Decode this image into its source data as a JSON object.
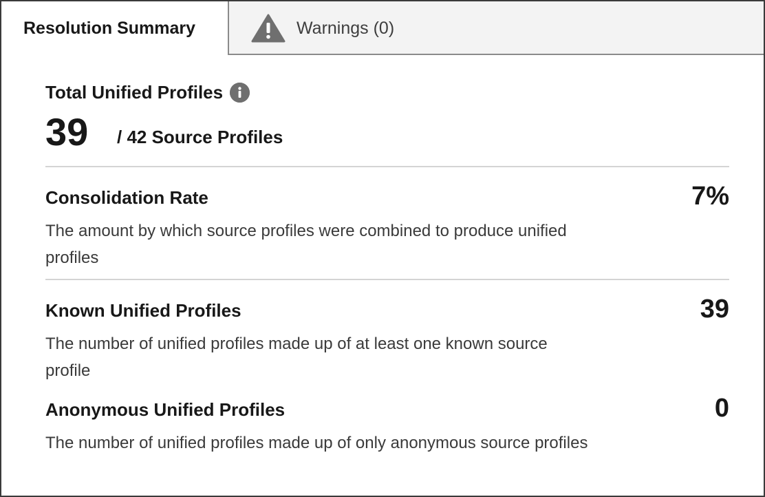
{
  "tabs": {
    "resolution_summary": "Resolution Summary",
    "warnings": "Warnings (0)"
  },
  "summary": {
    "total_title": "Total Unified Profiles",
    "total_value": "39",
    "total_of": "/ 42 Source Profiles"
  },
  "metrics": [
    {
      "title": "Consolidation Rate",
      "value": "7%",
      "description": "The amount by which source profiles were combined to produce unified profiles"
    },
    {
      "title": "Known Unified Profiles",
      "value": "39",
      "description": "The number of unified profiles made up of at least one known source profile"
    },
    {
      "title": "Anonymous Unified Profiles",
      "value": "0",
      "description": "The number of unified profiles made up of only anonymous source profiles"
    }
  ],
  "icons": {
    "warning": "warning-triangle-icon",
    "info": "info-icon"
  },
  "colors": {
    "warning_icon": "#6f6f6f",
    "info_icon": "#6f6f6f",
    "tab_inactive_bg": "#f3f3f3"
  }
}
